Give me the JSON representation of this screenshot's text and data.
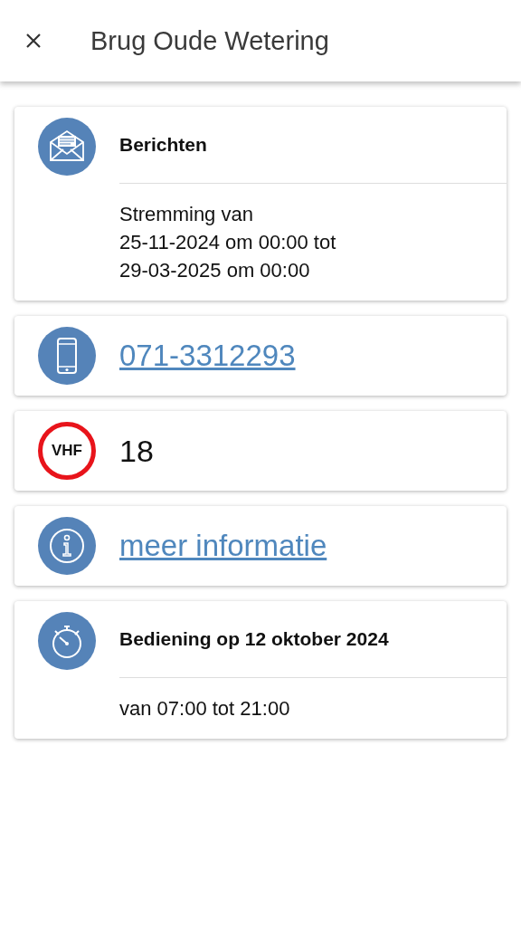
{
  "header": {
    "title": "Brug Oude Wetering"
  },
  "cards": [
    {
      "kind": "messages",
      "title": "Berichten",
      "lines": [
        "Stremming van",
        "25-11-2024 om 00:00 tot",
        "29-03-2025 om 00:00"
      ]
    },
    {
      "kind": "phone",
      "link": "071-3312293"
    },
    {
      "kind": "vhf",
      "badge": "VHF",
      "value": "18"
    },
    {
      "kind": "info",
      "link": "meer informatie"
    },
    {
      "kind": "hours",
      "title": "Bediening op 12 oktober 2024",
      "lines": [
        "van 07:00 tot 21:00"
      ]
    }
  ]
}
